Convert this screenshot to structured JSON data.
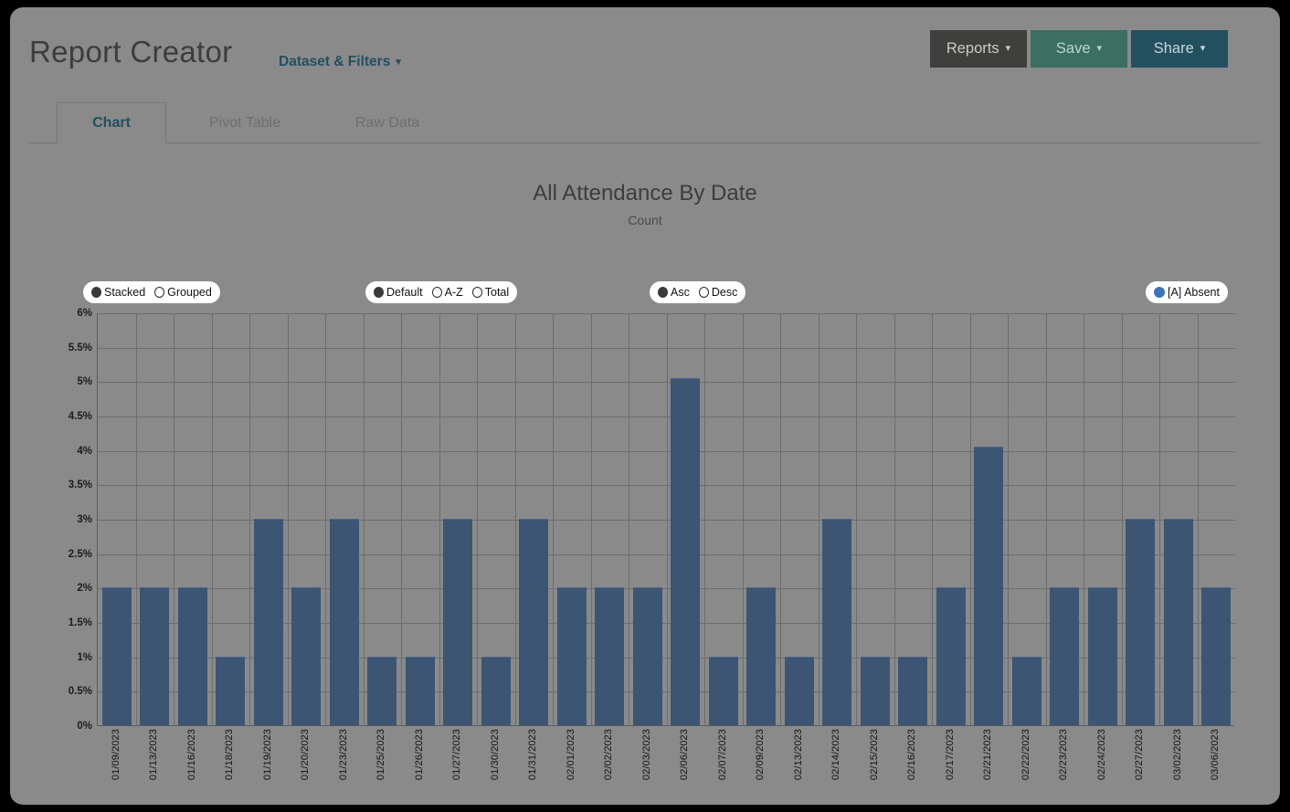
{
  "header": {
    "title": "Report Creator",
    "dataset_filters": {
      "label": "Dataset & Filters",
      "icon": "chevron-down-icon"
    },
    "actions": [
      {
        "label": "Reports",
        "icon": "chevron-down-icon",
        "color": "#3f3f3d"
      },
      {
        "label": "Save",
        "icon": "chevron-down-icon",
        "color": "#3a6f62"
      },
      {
        "label": "Share",
        "icon": "chevron-down-icon",
        "color": "#22505f"
      }
    ]
  },
  "tabs": [
    {
      "label": "Chart",
      "active": true
    },
    {
      "label": "Pivot Table",
      "active": false
    },
    {
      "label": "Raw Data",
      "active": false
    }
  ],
  "controls": {
    "stacking": {
      "selected": "Stacked",
      "options": [
        {
          "label": "Stacked",
          "selected": true
        },
        {
          "label": "Grouped",
          "selected": false
        }
      ]
    },
    "sort_mode": {
      "selected": "Default",
      "options": [
        {
          "label": "Default",
          "selected": true
        },
        {
          "label": "A-Z",
          "selected": false
        },
        {
          "label": "Total",
          "selected": false
        }
      ]
    },
    "sort_direction": {
      "selected": "Asc",
      "options": [
        {
          "label": "Asc",
          "selected": true
        },
        {
          "label": "Desc",
          "selected": false
        }
      ]
    }
  },
  "chart_data": {
    "type": "bar",
    "title": "All Attendance By Date",
    "subtitle": "Count",
    "xlabel": "",
    "ylabel": "",
    "ylim": [
      0,
      6
    ],
    "ytick_labels": [
      "0%",
      "0.5%",
      "1%",
      "1.5%",
      "2%",
      "2.5%",
      "3%",
      "3.5%",
      "4%",
      "4.5%",
      "5%",
      "5.5%",
      "6%"
    ],
    "ytick_values": [
      0,
      0.5,
      1,
      1.5,
      2,
      2.5,
      3,
      3.5,
      4,
      4.5,
      5,
      5.5,
      6
    ],
    "grid": true,
    "legend_position": "top-right",
    "legend": [
      {
        "label": "[A] Absent",
        "color": "#3a76bd"
      }
    ],
    "bar_color": "#3c5573",
    "categories": [
      "01/09/2023",
      "01/13/2023",
      "01/16/2023",
      "01/18/2023",
      "01/19/2023",
      "01/20/2023",
      "01/23/2023",
      "01/25/2023",
      "01/26/2023",
      "01/27/2023",
      "01/30/2023",
      "01/31/2023",
      "02/01/2023",
      "02/02/2023",
      "02/03/2023",
      "02/06/2023",
      "02/07/2023",
      "02/09/2023",
      "02/13/2023",
      "02/14/2023",
      "02/15/2023",
      "02/16/2023",
      "02/17/2023",
      "02/21/2023",
      "02/22/2023",
      "02/23/2023",
      "02/24/2023",
      "02/27/2023",
      "03/02/2023",
      "03/06/2023"
    ],
    "series": [
      {
        "name": "[A] Absent",
        "color": "#3c5573",
        "values": [
          2,
          2,
          2,
          1,
          3,
          2,
          3,
          1,
          1,
          3,
          1,
          3,
          2,
          2,
          2,
          5.05,
          1,
          2,
          1,
          3,
          1,
          1,
          2,
          4.05,
          1,
          2,
          2,
          3,
          3,
          2
        ]
      }
    ]
  }
}
